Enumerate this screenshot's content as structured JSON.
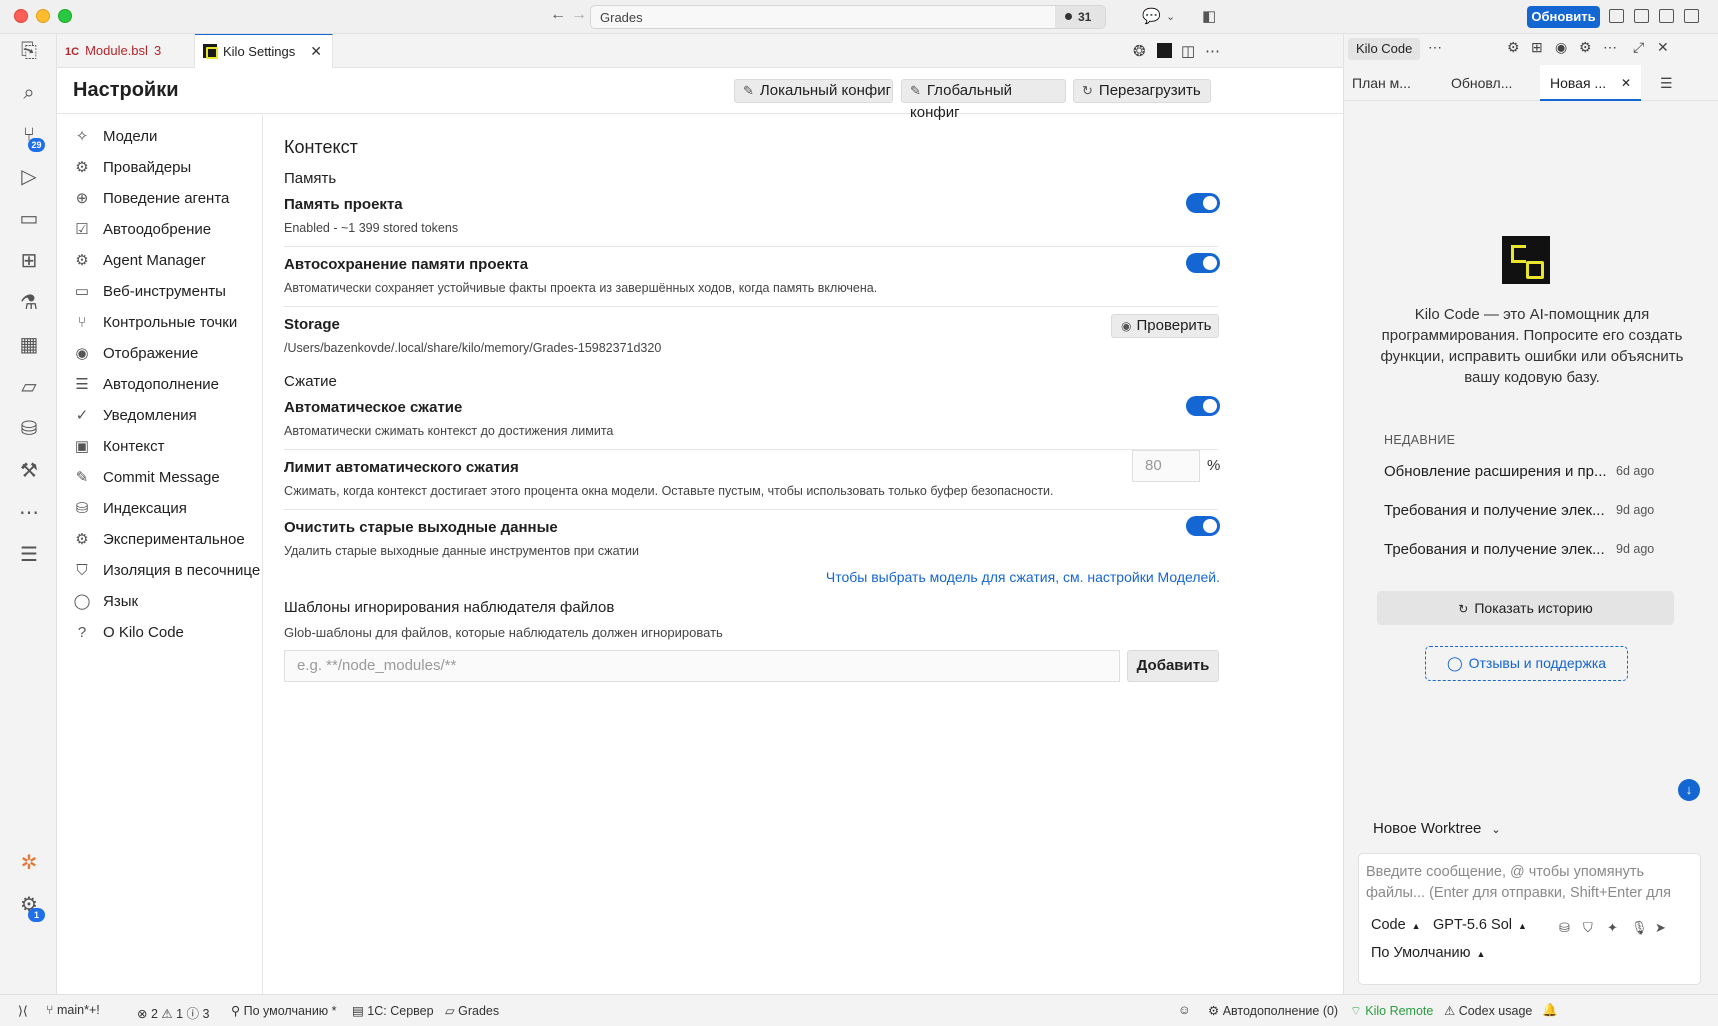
{
  "titlebar": {
    "command_center": "Grades",
    "badge_count": "31",
    "update_button": "Обновить"
  },
  "activity": {
    "scm_badge": "29",
    "settings_badge": "1"
  },
  "tabs": [
    {
      "label": "Module.bsl",
      "count": "3",
      "prefix": "1C"
    },
    {
      "label": "Kilo Settings"
    }
  ],
  "settings": {
    "title": "Настройки",
    "buttons": {
      "local_config": "Локальный конфиг",
      "global_config": "Глобальный конфиг",
      "reload": "Перезагрузить"
    },
    "nav": [
      {
        "label": "Модели",
        "icon": "sparkle-icon"
      },
      {
        "label": "Провайдеры",
        "icon": "chip-icon"
      },
      {
        "label": "Поведение агента",
        "icon": "agent-icon"
      },
      {
        "label": "Автоодобрение",
        "icon": "checklist-icon"
      },
      {
        "label": "Agent Manager",
        "icon": "gear-icon"
      },
      {
        "label": "Веб-инструменты",
        "icon": "browser-icon"
      },
      {
        "label": "Контрольные точки",
        "icon": "branch-icon"
      },
      {
        "label": "Отображение",
        "icon": "eye-icon"
      },
      {
        "label": "Автодополнение",
        "icon": "lines-icon"
      },
      {
        "label": "Уведомления",
        "icon": "check-circle-icon"
      },
      {
        "label": "Контекст",
        "icon": "panel-icon"
      },
      {
        "label": "Commit Message",
        "icon": "edit-icon"
      },
      {
        "label": "Индексация",
        "icon": "database-icon"
      },
      {
        "label": "Экспериментальное",
        "icon": "gear-icon"
      },
      {
        "label": "Изоляция в песочнице",
        "icon": "shield-icon"
      },
      {
        "label": "Язык",
        "icon": "chat-bubble-icon"
      },
      {
        "label": "О Kilo Code",
        "icon": "help-icon"
      }
    ],
    "context": {
      "title": "Контекст",
      "memory_heading": "Память",
      "project_memory": {
        "title": "Память проекта",
        "desc": "Enabled - ~1 399 stored tokens",
        "enabled": true
      },
      "autosave_memory": {
        "title": "Автосохранение памяти проекта",
        "desc": "Автоматически сохраняет устойчивые факты проекта из завершённых ходов, когда память включена.",
        "enabled": true
      },
      "storage": {
        "title": "Storage",
        "path": "/Users/bazenkovde/.local/share/kilo/memory/Grades-15982371d320",
        "button": "Проверить"
      },
      "compression_heading": "Сжатие",
      "auto_compress": {
        "title": "Автоматическое сжатие",
        "desc": "Автоматически сжимать контекст до достижения лимита",
        "enabled": true
      },
      "compress_limit": {
        "title": "Лимит автоматического сжатия",
        "desc": "Сжимать, когда контекст достигает этого процента окна модели. Оставьте пустым, чтобы использовать только буфер безопасности.",
        "value": "80",
        "unit": "%"
      },
      "clear_outputs": {
        "title": "Очистить старые выходные данные",
        "desc": "Удалить старые выходные данные инструментов при сжатии",
        "enabled": true
      },
      "model_link": "Чтобы выбрать модель для сжатия, см. настройки Моделей.",
      "ignore_patterns": {
        "title": "Шаблоны игнорирования наблюдателя файлов",
        "desc": "Glob-шаблоны для файлов, которые наблюдатель должен игнорировать",
        "placeholder": "e.g. **/node_modules/**",
        "add_button": "Добавить"
      }
    }
  },
  "kilo_panel": {
    "title": "Kilo Code",
    "tabs": [
      "План м...",
      "Обновл...",
      "Новая ..."
    ],
    "intro": "Kilo Code — это AI-помощник для программирования. Попросите его создать функции, исправить ошибки или объяснить вашу кодовую базу.",
    "recent_heading": "НЕДАВНИЕ",
    "recent": [
      {
        "title": "Обновление расширения и пр...",
        "time": "6d ago"
      },
      {
        "title": "Требования и получение элек...",
        "time": "9d ago"
      },
      {
        "title": "Требования и получение элек...",
        "time": "9d ago"
      }
    ],
    "history_button": "Показать историю",
    "feedback_button": "Отзывы и поддержка",
    "worktree": "Новое Worktree",
    "input_placeholder": "Введите сообщение, @ чтобы упомянуть файлы... (Enter для отправки, Shift+Enter для новой строки)",
    "mode": "Code",
    "model": "GPT-5.6 Sol",
    "profile": "По Умолчанию"
  },
  "statusbar": {
    "branch": "main*+!",
    "errors": "2",
    "warnings": "1",
    "infos": "3",
    "profile": "По умолчанию *",
    "server": "1С: Сервер",
    "folder": "Grades",
    "autocomplete": "Автодополнение (0)",
    "kilo_remote": "Kilo Remote",
    "codex": "Codex usage"
  },
  "colors": {
    "accent": "#1466d3",
    "toggle_on": "#1466d3",
    "kilo_yellow": "#e9e52c"
  }
}
